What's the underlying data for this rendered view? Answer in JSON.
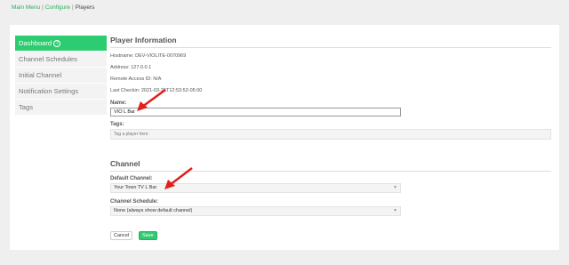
{
  "breadcrumb": {
    "main_menu": "Main Menu",
    "configure": "Configure",
    "current": "Players",
    "sep": "|"
  },
  "sidebar": {
    "items": [
      {
        "label": "Dashboard",
        "help": "?"
      },
      {
        "label": "Channel Schedules"
      },
      {
        "label": "Initial Channel"
      },
      {
        "label": "Notification Settings"
      },
      {
        "label": "Tags"
      }
    ]
  },
  "player_info": {
    "heading": "Player Information",
    "hostname": "Hostname: DEV-VIOLITE-0070969",
    "address": "Address: 127.0.0.1",
    "remote": "Remote Access ID: N/A",
    "last_checkin": "Last Checkin: 2021-03-26T12:53:52-05:00",
    "name_label": "Name:",
    "name_value": "VIO L Bar",
    "tags_label": "Tags:",
    "tags_placeholder": "Tag a player here"
  },
  "channel": {
    "heading": "Channel",
    "default_label": "Default Channel:",
    "default_value": "Your Town TV L Bar",
    "schedule_label": "Channel Schedule:",
    "schedule_value": "None (always show default channel)"
  },
  "buttons": {
    "cancel": "Cancel",
    "save": "Save"
  },
  "colors": {
    "accent": "#2ecc71",
    "annotation_arrow": "#e0201b"
  }
}
